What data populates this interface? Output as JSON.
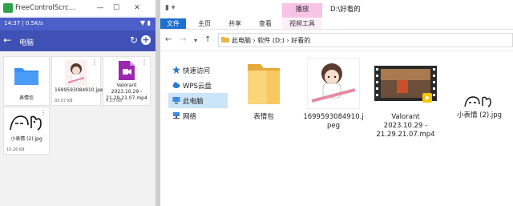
{
  "left": {
    "title": "FreeControlScrc...",
    "status_time": "14:37 | 0.5K/s",
    "status_icons": "▼ ▮",
    "toolbar_title": "电脑",
    "files": [
      {
        "name": "表情包",
        "size": "",
        "kind": "folder"
      },
      {
        "name": "1699593084910.jpeg",
        "size": "93.07 KB",
        "kind": "image"
      },
      {
        "name": "Valorant 2023.10.29 - 21.29.21.07.mp4",
        "size": "4.23 GB",
        "kind": "video"
      },
      {
        "name": "小表情 (2).jpg",
        "size": "10.26 KB",
        "kind": "sticker"
      }
    ]
  },
  "right": {
    "tool_tab": "播放",
    "path_title": "D:\\好看的",
    "ribbon_tabs": [
      "文件",
      "主页",
      "共享",
      "查看",
      "视频工具"
    ],
    "breadcrumb": "此电脑  ›  软件 (D:)  ›  好看的",
    "sidebar": [
      "快速访问",
      "WPS云盘",
      "此电脑",
      "网络"
    ],
    "files": [
      {
        "name": "表情包",
        "kind": "folder"
      },
      {
        "name": "1699593084910.jpeg",
        "kind": "image"
      },
      {
        "name": "Valorant 2023.10.29 - 21.29.21.07.mp4",
        "kind": "video"
      },
      {
        "name": "小表情 (2).jpg",
        "kind": "sticker"
      }
    ]
  },
  "colors": {
    "toolbar": "#3f51b5",
    "status": "#4d5fc9",
    "file_tab": "#1d6fd1",
    "tool_tab": "#f7c4e6",
    "selected": "#cce4f7",
    "folder": "#f6c85f"
  }
}
